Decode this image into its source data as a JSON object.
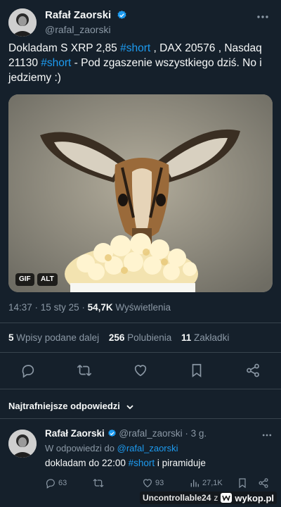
{
  "author": {
    "name": "Rafał Zaorski",
    "handle": "@rafal_zaorski"
  },
  "tweet": {
    "text_part1": "Dokladam S XRP 2,85 ",
    "hashtag1": "#short",
    "text_part2": " , DAX 20576 , Nasdaq 21130 ",
    "hashtag2": "#short",
    "text_part3": " - Pod zgaszenie wszystkiego dziś. No i jedziemy :)"
  },
  "media": {
    "badge_gif": "GIF",
    "badge_alt": "ALT"
  },
  "meta": {
    "time": "14:37",
    "sep1": " · ",
    "date": "15 sty 25",
    "sep2": " · ",
    "views": "54,7K",
    "views_label": " Wyświetlenia"
  },
  "stats": [
    {
      "num": "5",
      "label": "Wpisy podane dalej"
    },
    {
      "num": "256",
      "label": "Polubienia"
    },
    {
      "num": "11",
      "label": "Zakładki"
    }
  ],
  "actions": [
    {
      "icon": "reply-icon"
    },
    {
      "icon": "repost-icon"
    },
    {
      "icon": "like-icon"
    },
    {
      "icon": "bookmark-icon"
    },
    {
      "icon": "share-icon"
    }
  ],
  "replies_sort": {
    "label": "Najtrafniejsze odpowiedzi"
  },
  "reply": {
    "name": "Rafał Zaorski",
    "handle": "@rafal_zaorski",
    "sep": " · ",
    "time": "3 g.",
    "reply_to_prefix": "W odpowiedzi do ",
    "reply_to_handle": "@rafal_zaorski",
    "text_part1": "dokladam do 22:00 ",
    "hashtag": "#short",
    "text_part2": " i piramiduje",
    "counts": {
      "replies": "63",
      "reposts": "",
      "likes": "93",
      "views": "27,1K"
    }
  },
  "watermark": {
    "user": "Uncontrollable24",
    "word": "z",
    "site": "wykop.pl"
  },
  "colors": {
    "background": "#15202b",
    "accent": "#1d9bf0",
    "secondary_text": "#8b98a5",
    "divider": "#38444d"
  }
}
